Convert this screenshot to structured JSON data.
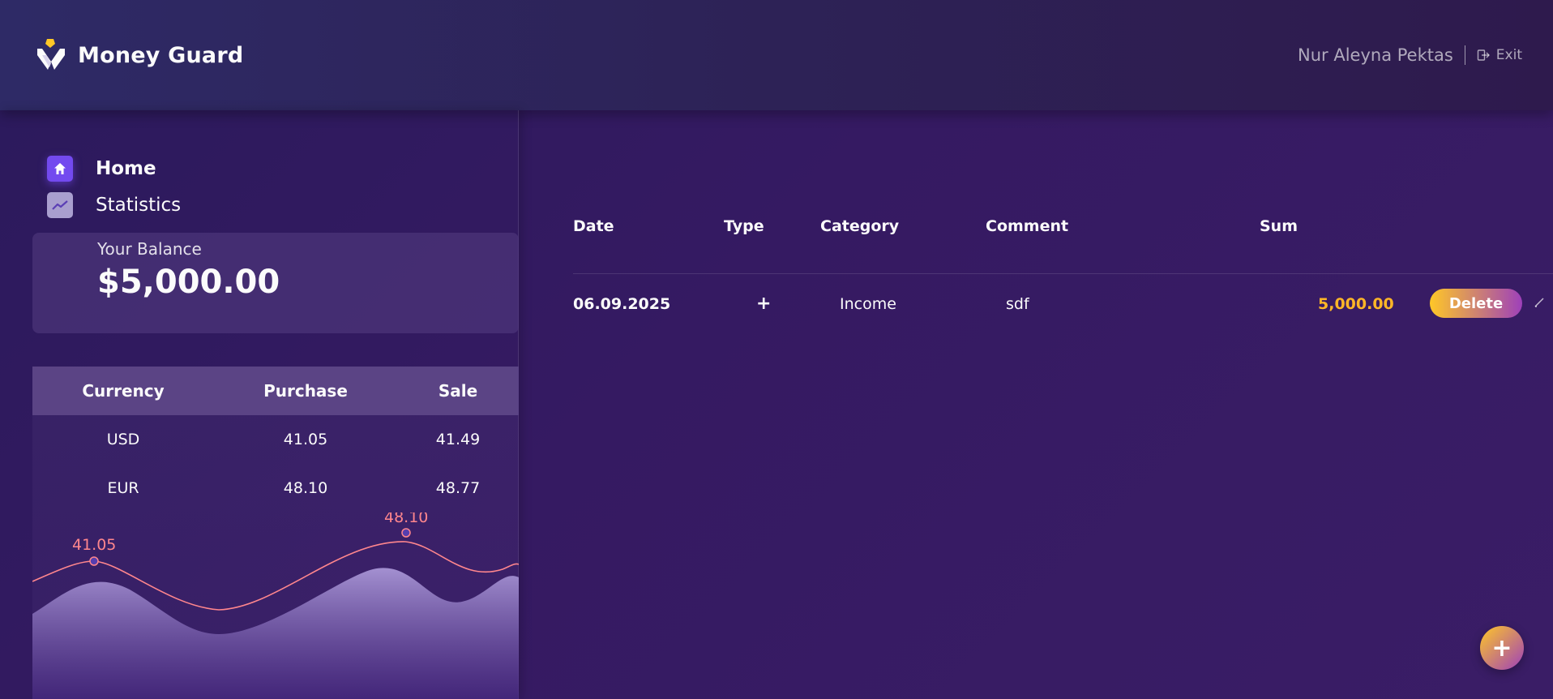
{
  "header": {
    "app_name": "Money Guard",
    "user_name": "Nur Aleyna Pektas",
    "exit_label": "Exit"
  },
  "nav": {
    "items": [
      {
        "label": "Home",
        "icon": "home-icon",
        "active": true
      },
      {
        "label": "Statistics",
        "icon": "statistics-icon",
        "active": false
      }
    ]
  },
  "balance": {
    "label": "Your Balance",
    "value": "$5,000.00"
  },
  "currency": {
    "headers": [
      "Currency",
      "Purchase",
      "Sale"
    ],
    "rows": [
      [
        "USD",
        "41.05",
        "41.49"
      ],
      [
        "EUR",
        "48.10",
        "48.77"
      ]
    ],
    "chart_labels": [
      "41.05",
      "48.10"
    ]
  },
  "transactions": {
    "headers": [
      "Date",
      "Type",
      "Category",
      "Comment",
      "Sum"
    ],
    "rows": [
      {
        "date": "06.09.2025",
        "type": "+",
        "category": "Income",
        "comment": "sdf",
        "sum": "5,000.00",
        "delete_label": "Delete"
      }
    ]
  },
  "colors": {
    "accent_yellow": "#FFB627",
    "accent_purple": "#734AEF",
    "chart_line": "#FF868D"
  }
}
